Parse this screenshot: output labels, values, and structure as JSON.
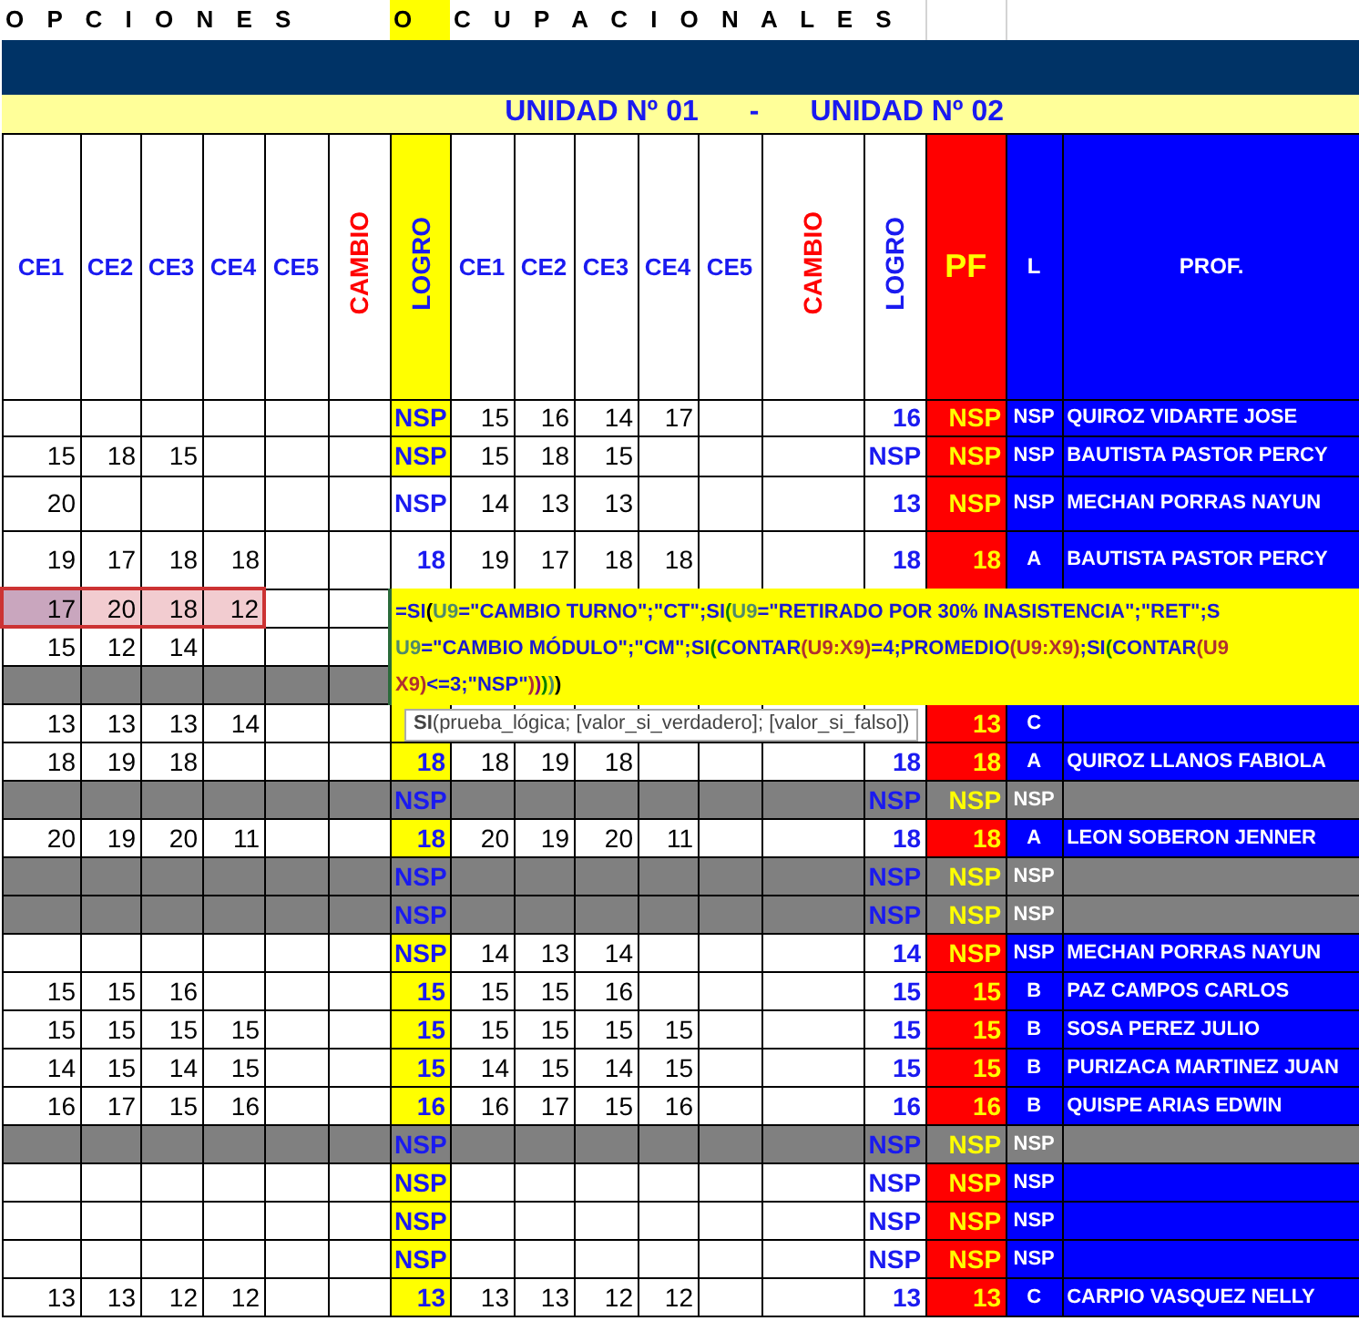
{
  "title": {
    "part1": "O P C I O N E S",
    "highlighted_letter": "O",
    "part2": "C U P A C I O N A L E S"
  },
  "units_banner": {
    "unit1": "UNIDAD Nº 01",
    "separator": "-",
    "unit2": "UNIDAD Nº 02"
  },
  "columns": [
    {
      "label": "CE1",
      "kind": "ce"
    },
    {
      "label": "CE2",
      "kind": "ce"
    },
    {
      "label": "CE3",
      "kind": "ce"
    },
    {
      "label": "CE4",
      "kind": "ce"
    },
    {
      "label": "CE5",
      "kind": "ce"
    },
    {
      "label": "CAMBIO",
      "kind": "cambio"
    },
    {
      "label": "LOGRO",
      "kind": "logro1"
    },
    {
      "label": "CE1",
      "kind": "ce"
    },
    {
      "label": "CE2",
      "kind": "ce"
    },
    {
      "label": "CE3",
      "kind": "ce"
    },
    {
      "label": "CE4",
      "kind": "ce"
    },
    {
      "label": "CE5",
      "kind": "ce"
    },
    {
      "label": "CAMBIO",
      "kind": "cambio"
    },
    {
      "label": "LOGRO",
      "kind": "logro2"
    },
    {
      "label": "PF",
      "kind": "pf"
    },
    {
      "label": "L",
      "kind": "l"
    },
    {
      "label": "PROF.",
      "kind": "prof"
    }
  ],
  "rows": [
    {
      "kind": "student",
      "ce_selected": false,
      "u1": [],
      "logro1": "NSP",
      "logro1_highlight": true,
      "u2": [
        "15",
        "16",
        "14",
        "17"
      ],
      "logro2": "16",
      "pf": "NSP",
      "l": "NSP",
      "prof": "QUIROZ VIDARTE JOSE"
    },
    {
      "kind": "student",
      "ce_selected": false,
      "u1": [
        "15",
        "18",
        "15"
      ],
      "logro1": "NSP",
      "logro1_highlight": true,
      "u2": [
        "15",
        "18",
        "15"
      ],
      "logro2": "NSP",
      "pf": "NSP",
      "l": "NSP",
      "prof": "BAUTISTA PASTOR PERCY"
    },
    {
      "kind": "student",
      "ce_selected": false,
      "u1": [
        "20"
      ],
      "logro1": "NSP",
      "logro1_highlight": false,
      "u2": [
        "14",
        "13",
        "13"
      ],
      "logro2": "13",
      "pf": "NSP",
      "l": "NSP",
      "prof": "MECHAN PORRAS NAYUN"
    },
    {
      "kind": "student",
      "ce_selected": false,
      "u1": [
        "19",
        "17",
        "18",
        "18"
      ],
      "logro1": "18",
      "logro1_highlight": false,
      "u2": [
        "19",
        "17",
        "18",
        "18"
      ],
      "logro2": "18",
      "pf": "18",
      "l": "A",
      "prof": "BAUTISTA PASTOR PERCY"
    },
    {
      "kind": "student",
      "ce_selected": true,
      "u1": [
        "17",
        "20",
        "18",
        "12"
      ]
    },
    {
      "kind": "student",
      "ce_selected": false,
      "u1": [
        "15",
        "12",
        "14"
      ]
    },
    {
      "kind": "blank",
      "ce_selected": false
    },
    {
      "kind": "student",
      "ce_selected": false,
      "u1": [
        "13",
        "13",
        "13",
        "14"
      ],
      "logro1_highlight": true,
      "pf": "13",
      "l": "C"
    },
    {
      "kind": "student",
      "ce_selected": false,
      "u1": [
        "18",
        "19",
        "18"
      ],
      "logro1": "18",
      "logro1_highlight": true,
      "u2": [
        "18",
        "19",
        "18"
      ],
      "logro2": "18",
      "pf": "18",
      "l": "A",
      "prof": "QUIROZ LLANOS FABIOLA"
    },
    {
      "kind": "blank",
      "ce_selected": false,
      "logro1": "NSP",
      "logro2": "NSP",
      "pf": "NSP",
      "l": "NSP"
    },
    {
      "kind": "student",
      "ce_selected": false,
      "u1": [
        "20",
        "19",
        "20",
        "11"
      ],
      "logro1": "18",
      "logro1_highlight": true,
      "u2": [
        "20",
        "19",
        "20",
        "11"
      ],
      "logro2": "18",
      "pf": "18",
      "l": "A",
      "prof": "LEON SOBERON JENNER"
    },
    {
      "kind": "blank",
      "ce_selected": false,
      "logro1": "NSP",
      "logro2": "NSP",
      "pf": "NSP",
      "l": "NSP"
    },
    {
      "kind": "blank",
      "ce_selected": false,
      "logro1": "NSP",
      "logro2": "NSP",
      "pf": "NSP",
      "l": "NSP"
    },
    {
      "kind": "student",
      "ce_selected": false,
      "u1": [],
      "logro1": "NSP",
      "logro1_highlight": true,
      "u2": [
        "14",
        "13",
        "14"
      ],
      "logro2": "14",
      "pf": "NSP",
      "l": "NSP",
      "prof": "MECHAN PORRAS NAYUN"
    },
    {
      "kind": "student",
      "ce_selected": false,
      "u1": [
        "15",
        "15",
        "16"
      ],
      "logro1": "15",
      "logro1_highlight": true,
      "u2": [
        "15",
        "15",
        "16"
      ],
      "logro2": "15",
      "pf": "15",
      "l": "B",
      "prof": "PAZ CAMPOS CARLOS"
    },
    {
      "kind": "student",
      "ce_selected": false,
      "u1": [
        "15",
        "15",
        "15",
        "15"
      ],
      "logro1": "15",
      "logro1_highlight": true,
      "u2": [
        "15",
        "15",
        "15",
        "15"
      ],
      "logro2": "15",
      "pf": "15",
      "l": "B",
      "prof": "SOSA PEREZ JULIO"
    },
    {
      "kind": "student",
      "ce_selected": false,
      "u1": [
        "14",
        "15",
        "14",
        "15"
      ],
      "logro1": "15",
      "logro1_highlight": true,
      "u2": [
        "14",
        "15",
        "14",
        "15"
      ],
      "logro2": "15",
      "pf": "15",
      "l": "B",
      "prof": "PURIZACA MARTINEZ JUAN"
    },
    {
      "kind": "student",
      "ce_selected": false,
      "u1": [
        "16",
        "17",
        "15",
        "16"
      ],
      "logro1": "16",
      "logro1_highlight": true,
      "u2": [
        "16",
        "17",
        "15",
        "16"
      ],
      "logro2": "16",
      "pf": "16",
      "l": "B",
      "prof": "QUISPE ARIAS EDWIN"
    },
    {
      "kind": "blank",
      "ce_selected": false,
      "logro1": "NSP",
      "logro2": "NSP",
      "pf": "NSP",
      "l": "NSP"
    },
    {
      "kind": "student",
      "ce_selected": false,
      "u1": [],
      "logro1": "NSP",
      "logro1_highlight": true,
      "u2": [],
      "logro2": "NSP",
      "pf": "NSP",
      "l": "NSP"
    },
    {
      "kind": "student",
      "ce_selected": false,
      "u1": [],
      "logro1": "NSP",
      "logro1_highlight": true,
      "u2": [],
      "logro2": "NSP",
      "pf": "NSP",
      "l": "NSP"
    },
    {
      "kind": "student",
      "ce_selected": false,
      "u1": [],
      "logro1": "NSP",
      "logro1_highlight": true,
      "u2": [],
      "logro2": "NSP",
      "pf": "NSP",
      "l": "NSP"
    },
    {
      "kind": "student",
      "ce_selected": false,
      "u1": [
        "13",
        "13",
        "12",
        "12"
      ],
      "logro1": "13",
      "logro1_highlight": true,
      "u2": [
        "13",
        "13",
        "12",
        "12"
      ],
      "logro2": "13",
      "pf": "13",
      "l": "C",
      "prof": "CARPIO VASQUEZ NELLY"
    }
  ],
  "formula_editor": {
    "lines": [
      [
        {
          "text": "=SI",
          "color": "#1a1ad0"
        },
        {
          "text": "(",
          "color": "#000000"
        },
        {
          "text": "U9",
          "color": "#4f8a6a"
        },
        {
          "text": "=\"CAMBIO TURNO\";\"CT\";SI",
          "color": "#1a1ad0"
        },
        {
          "text": "(",
          "color": "#008000"
        },
        {
          "text": "U9",
          "color": "#4f8a6a"
        },
        {
          "text": "=\"RETIRADO POR 30% INASISTENCIA\";\"RET\";S",
          "color": "#1a1ad0"
        }
      ],
      [
        {
          "text": "U9",
          "color": "#4f8a6a"
        },
        {
          "text": "=\"CAMBIO MÓDULO\";\"CM\";SI",
          "color": "#1a1ad0"
        },
        {
          "text": "(",
          "color": "#008000"
        },
        {
          "text": "CONTAR",
          "color": "#1a1ad0"
        },
        {
          "text": "(U9:X9)",
          "color": "#b03030"
        },
        {
          "text": "=4;PROMEDIO",
          "color": "#1a1ad0"
        },
        {
          "text": "(U9:X9)",
          "color": "#b03030"
        },
        {
          "text": ";SI",
          "color": "#1a1ad0"
        },
        {
          "text": "(",
          "color": "#008000"
        },
        {
          "text": "CONTAR",
          "color": "#1a1ad0"
        },
        {
          "text": "(U9",
          "color": "#b03030"
        }
      ],
      [
        {
          "text": "X9)",
          "color": "#b03030"
        },
        {
          "text": "<=3;\"NSP\"",
          "color": "#1a1ad0"
        },
        {
          "text": ")",
          "color": "#b03030"
        },
        {
          "text": ")",
          "color": "#800080"
        },
        {
          "text": ")",
          "color": "#008000"
        },
        {
          "text": ")",
          "color": "#4f8a6a"
        },
        {
          "text": ")",
          "color": "#000000"
        }
      ]
    ]
  },
  "tooltip": "**SI**(prueba_lógica; [valor_si_verdadero]; [valor_si_falso])"
}
